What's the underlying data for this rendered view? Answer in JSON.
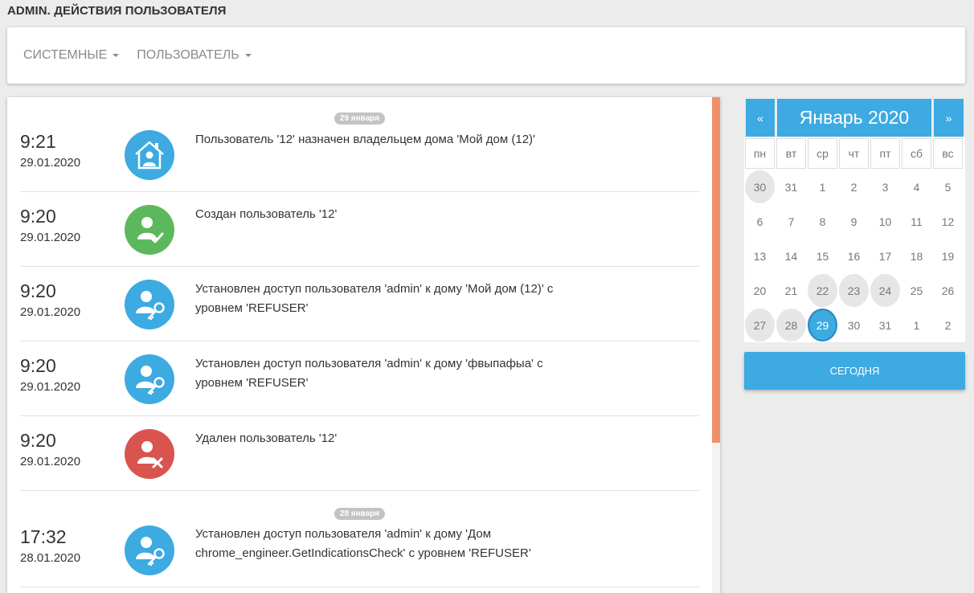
{
  "page": {
    "title": "ADMIN. ДЕЙСТВИЯ ПОЛЬЗОВАТЕЛЯ"
  },
  "filters": {
    "system_label": "СИСТЕМНЫЕ",
    "user_label": "ПОЛЬЗОВАТЕЛЬ"
  },
  "colors": {
    "accent": "#3daae1",
    "success": "#5cb85c",
    "danger": "#d9534f",
    "scrollbar": "#f0906a"
  },
  "log": {
    "groups": [
      {
        "label": "29 января"
      },
      {
        "label": "28 января"
      }
    ],
    "entries": [
      {
        "time": "9:21",
        "date": "29.01.2020",
        "icon": "user-house-icon",
        "message": "Пользователь '12' назначен владельцем дома 'Мой дом (12)'"
      },
      {
        "time": "9:20",
        "date": "29.01.2020",
        "icon": "user-check-icon",
        "message": "Создан пользователь '12'"
      },
      {
        "time": "9:20",
        "date": "29.01.2020",
        "icon": "user-key-icon",
        "message": "Установлен доступ пользователя 'admin' к дому 'Мой дом (12)' с уровнем 'REFUSER'"
      },
      {
        "time": "9:20",
        "date": "29.01.2020",
        "icon": "user-key-icon",
        "message": "Установлен доступ пользователя 'admin' к дому 'фвыпафыа' с уровнем 'REFUSER'"
      },
      {
        "time": "9:20",
        "date": "29.01.2020",
        "icon": "user-remove-icon",
        "message": "Удален пользователь '12'"
      },
      {
        "time": "17:32",
        "date": "28.01.2020",
        "icon": "user-key-icon",
        "message": "Установлен доступ пользователя 'admin' к дому 'Дом chrome_engineer.GetIndicationsCheck' с уровнем 'REFUSER'"
      }
    ]
  },
  "calendar": {
    "prev": "«",
    "next": "»",
    "title": "Январь 2020",
    "weekdays": [
      "пн",
      "вт",
      "ср",
      "чт",
      "пт",
      "сб",
      "вс"
    ],
    "weeks": [
      [
        "30",
        "31",
        "1",
        "2",
        "3",
        "4",
        "5"
      ],
      [
        "6",
        "7",
        "8",
        "9",
        "10",
        "11",
        "12"
      ],
      [
        "13",
        "14",
        "15",
        "16",
        "17",
        "18",
        "19"
      ],
      [
        "20",
        "21",
        "22",
        "23",
        "24",
        "25",
        "26"
      ],
      [
        "27",
        "28",
        "29",
        "30",
        "31",
        "1",
        "2"
      ]
    ],
    "today_label": "СЕГОДНЯ"
  }
}
